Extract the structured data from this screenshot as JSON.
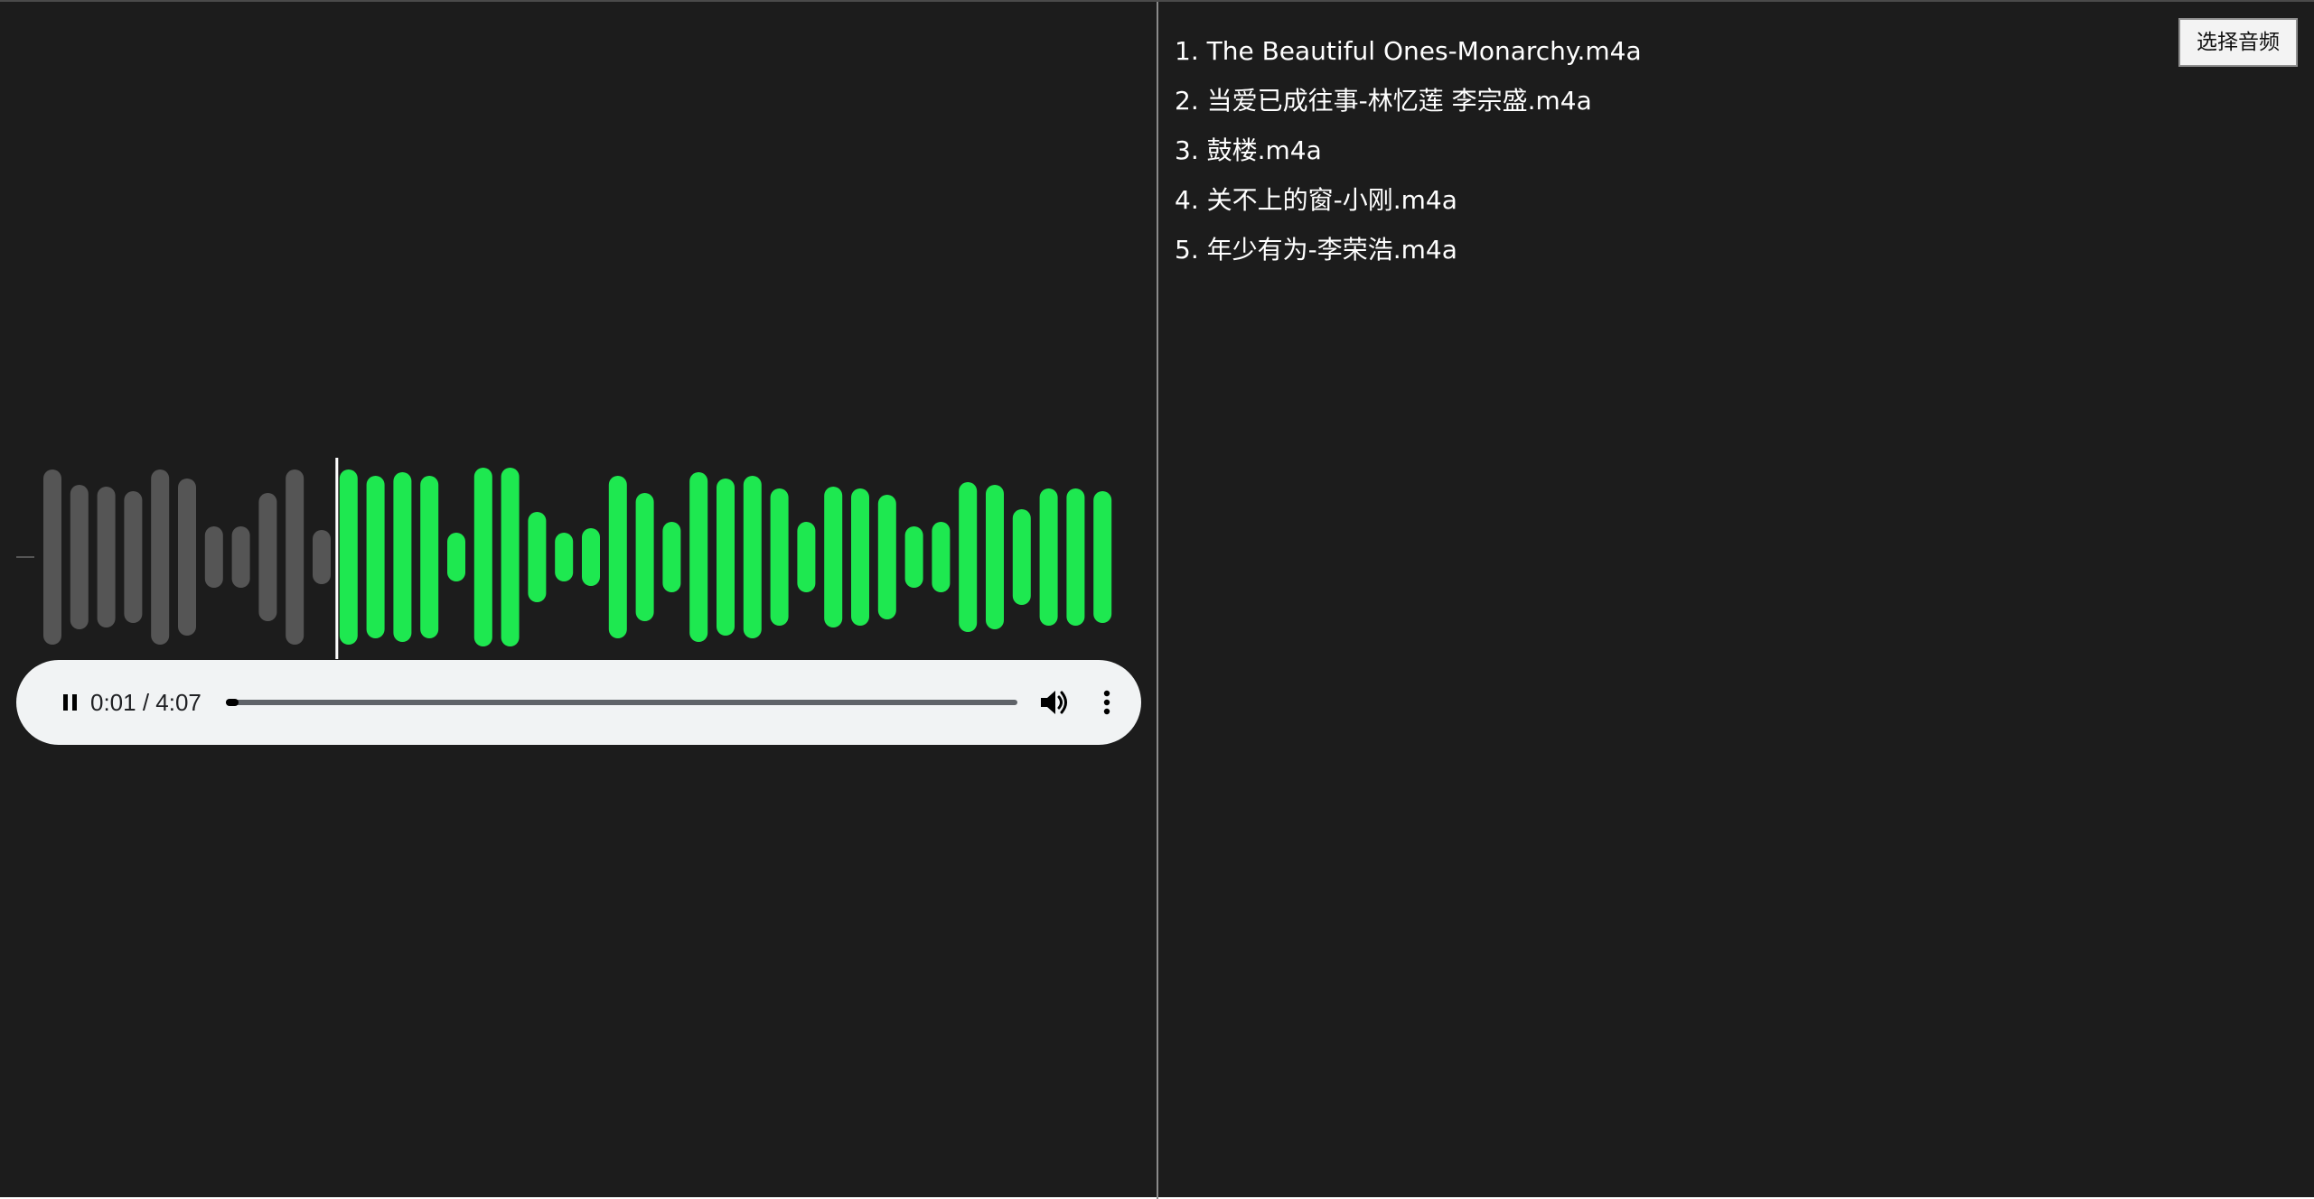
{
  "player": {
    "state": "playing",
    "current_time": "0:01",
    "duration": "4:07",
    "time_text": "0:01 / 4:07",
    "progress": 0.004,
    "play_pause_icon": "pause-icon",
    "volume_icon": "volume-icon",
    "more_icon": "more-options-icon",
    "background_color": "#f1f3f4"
  },
  "waveform": {
    "played_color": "#555555",
    "unplayed_color": "#1ee850",
    "playhead_color": "#ffffff",
    "bars": [
      {
        "amplitude": 0.97,
        "played": true
      },
      {
        "amplitude": 0.8,
        "played": true
      },
      {
        "amplitude": 0.78,
        "played": true
      },
      {
        "amplitude": 0.73,
        "played": true
      },
      {
        "amplitude": 0.97,
        "played": true
      },
      {
        "amplitude": 0.87,
        "played": true
      },
      {
        "amplitude": 0.34,
        "played": true
      },
      {
        "amplitude": 0.34,
        "played": true
      },
      {
        "amplitude": 0.71,
        "played": true
      },
      {
        "amplitude": 0.97,
        "played": true
      },
      {
        "amplitude": 0.3,
        "played": true
      },
      {
        "amplitude": 0.97,
        "played": false
      },
      {
        "amplitude": 0.9,
        "played": false
      },
      {
        "amplitude": 0.94,
        "played": false
      },
      {
        "amplitude": 0.9,
        "played": false
      },
      {
        "amplitude": 0.27,
        "played": false
      },
      {
        "amplitude": 0.99,
        "played": false
      },
      {
        "amplitude": 0.99,
        "played": false
      },
      {
        "amplitude": 0.5,
        "played": false
      },
      {
        "amplitude": 0.27,
        "played": false
      },
      {
        "amplitude": 0.32,
        "played": false
      },
      {
        "amplitude": 0.9,
        "played": false
      },
      {
        "amplitude": 0.71,
        "played": false
      },
      {
        "amplitude": 0.39,
        "played": false
      },
      {
        "amplitude": 0.94,
        "played": false
      },
      {
        "amplitude": 0.87,
        "played": false
      },
      {
        "amplitude": 0.9,
        "played": false
      },
      {
        "amplitude": 0.76,
        "played": false
      },
      {
        "amplitude": 0.39,
        "played": false
      },
      {
        "amplitude": 0.78,
        "played": false
      },
      {
        "amplitude": 0.76,
        "played": false
      },
      {
        "amplitude": 0.69,
        "played": false
      },
      {
        "amplitude": 0.34,
        "played": false
      },
      {
        "amplitude": 0.39,
        "played": false
      },
      {
        "amplitude": 0.83,
        "played": false
      },
      {
        "amplitude": 0.8,
        "played": false
      },
      {
        "amplitude": 0.53,
        "played": false
      },
      {
        "amplitude": 0.76,
        "played": false
      },
      {
        "amplitude": 0.76,
        "played": false
      },
      {
        "amplitude": 0.73,
        "played": false
      }
    ]
  },
  "sidebar": {
    "choose_button_label": "选择音频",
    "playlist": [
      "1. The Beautiful Ones-Monarchy.m4a",
      "2. 当爱已成往事-林忆莲 李宗盛.m4a",
      "3. 鼓楼.m4a",
      "4. 关不上的窗-小刚.m4a",
      "5. 年少有为-李荣浩.m4a"
    ]
  }
}
